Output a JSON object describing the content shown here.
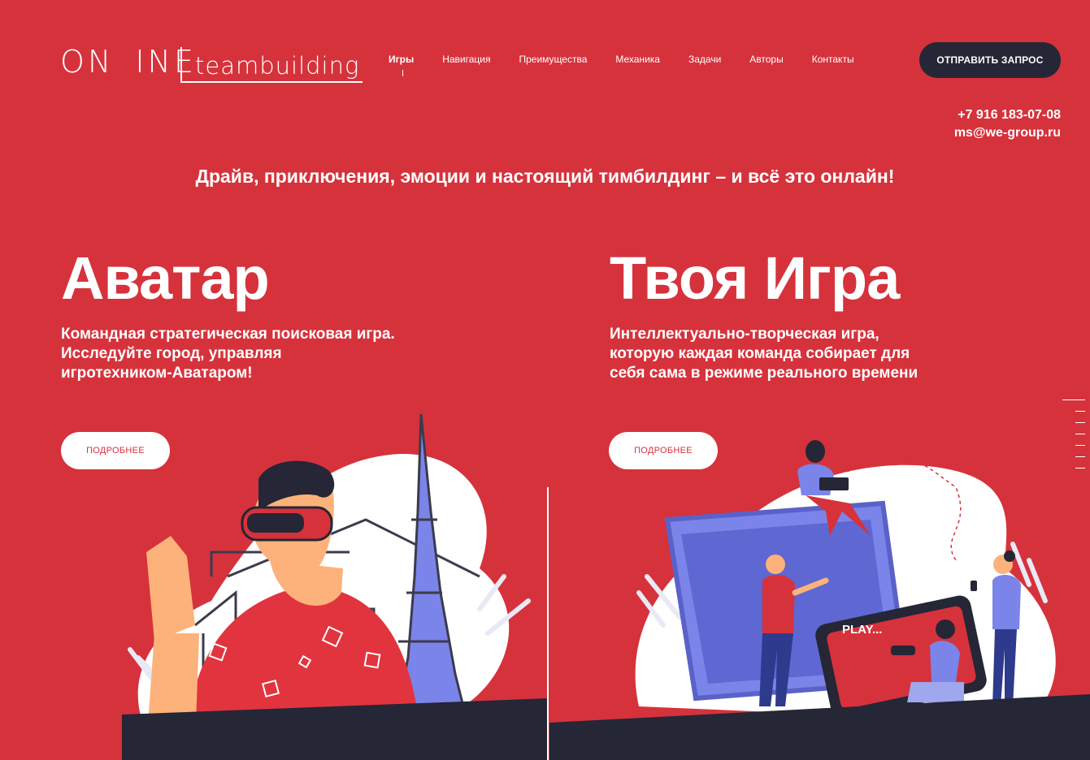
{
  "logo": {
    "on": "ON",
    "ine": "INE",
    "teambuilding": "teambuilding"
  },
  "nav": {
    "items": [
      {
        "label": "Игры",
        "active": true
      },
      {
        "label": "Навигация"
      },
      {
        "label": "Преимущества"
      },
      {
        "label": "Механика"
      },
      {
        "label": "Задачи"
      },
      {
        "label": "Авторы"
      },
      {
        "label": "Контакты"
      }
    ]
  },
  "cta": {
    "label": "ОТПРАВИТЬ ЗАПРОС"
  },
  "contacts": {
    "phone": "+7 916 183-07-08",
    "email": "ms@we-group.ru"
  },
  "tagline": "Драйв, приключения, эмоции и настоящий тимбилдинг – и всё это онлайн!",
  "games": [
    {
      "title": "Аватар",
      "desc_lines": [
        "Командная стратегическая поисковая игра.",
        "Исследуйте город, управляя",
        "игротехником-Аватаром!"
      ],
      "button": "ПОДРОБНЕЕ"
    },
    {
      "title": "Твоя Игра",
      "desc_lines": [
        "Интеллектуально-творческая игра,",
        "которую каждая команда собирает для",
        "себя сама в режиме реального времени"
      ],
      "button": "ПОДРОБНЕЕ",
      "screen_text": "PLAY..."
    }
  ],
  "colors": {
    "background": "#d6323c",
    "dark": "#252636",
    "accent_purple": "#6e76e0"
  }
}
